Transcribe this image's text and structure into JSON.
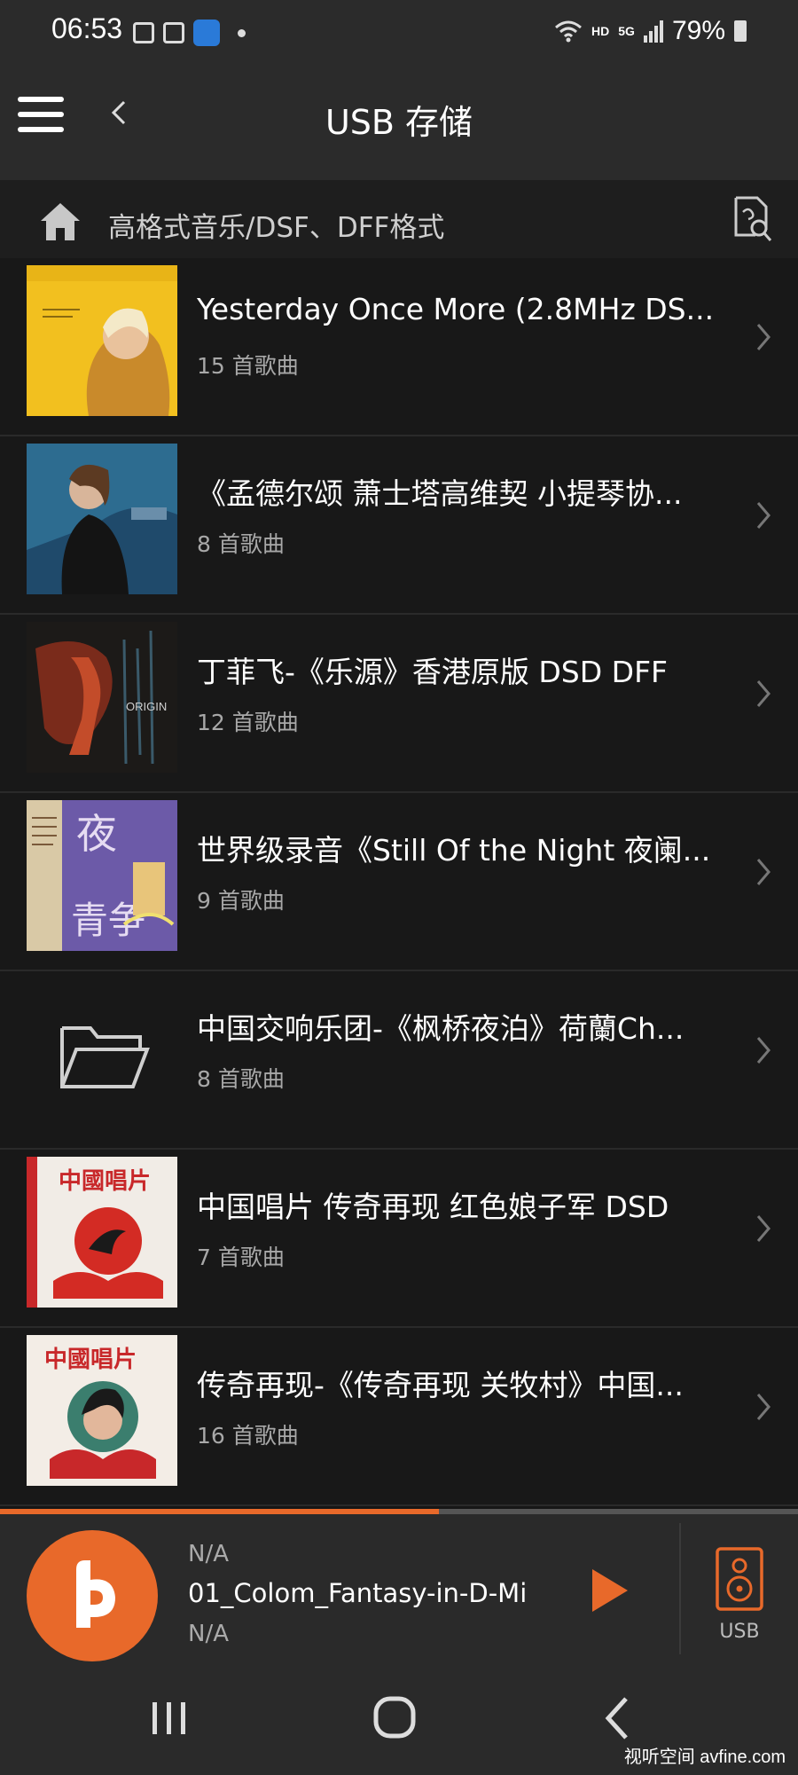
{
  "status_bar": {
    "time": "06:53",
    "battery": "79%",
    "hd_label": "HD",
    "network_label": "5G"
  },
  "app_bar": {
    "title": "USB 存储",
    "menu_icon": "hamburger-menu-icon",
    "back_icon": "chevron-left-icon"
  },
  "breadcrumb": {
    "path": "高格式音乐/DSF、DFF格式",
    "home_icon": "home-icon",
    "search_icon": "file-search-icon"
  },
  "albums": [
    {
      "title": "Yesterday Once More (2.8MHz DS...",
      "count": "15 首歌曲"
    },
    {
      "title": "《孟德尔颂 萧士塔高维契 小提琴协...",
      "count": "8 首歌曲"
    },
    {
      "title": "丁菲飞-《乐源》香港原版 DSD DFF",
      "count": "12 首歌曲"
    },
    {
      "title": "世界级录音《Still Of the Night 夜阑...",
      "count": "9 首歌曲"
    },
    {
      "title": "中国交响乐团-《枫桥夜泊》荷蘭Ch...",
      "count": "8 首歌曲"
    },
    {
      "title": "中国唱片 传奇再现 红色娘子军 DSD",
      "count": "7 首歌曲"
    },
    {
      "title": "传奇再现-《传奇再现 关牧村》中国...",
      "count": "16 首歌曲"
    }
  ],
  "cover_text": {
    "china_record": "中國唱片",
    "night_char": "夜",
    "quiet_char": "青争",
    "origin": "ORIGIN"
  },
  "player": {
    "artist": "N/A",
    "track": "01_Colom_Fantasy-in-D-Mi",
    "album": "N/A",
    "progress": 0.55,
    "device_label": "USB",
    "accent": "#e8692a"
  },
  "watermark": "视听空间 avfine.com"
}
